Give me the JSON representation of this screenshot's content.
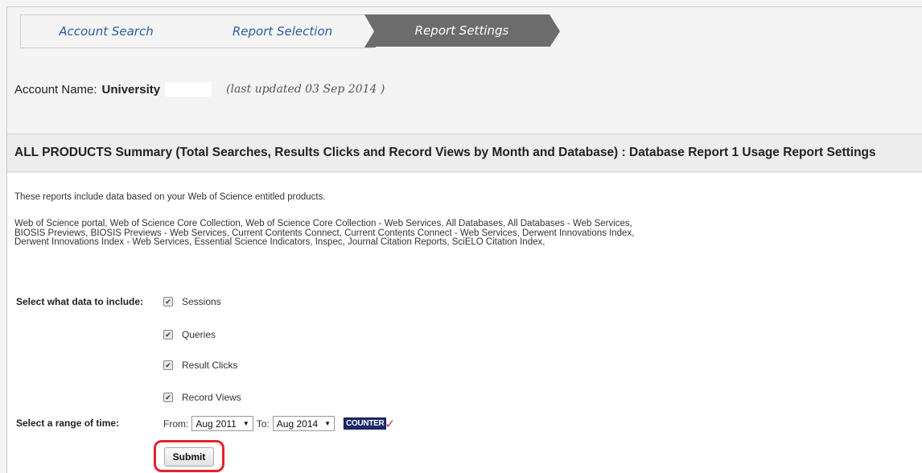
{
  "steps": [
    {
      "label": "Account Search"
    },
    {
      "label": "Report Selection"
    },
    {
      "label": "Report Settings"
    }
  ],
  "account": {
    "label": "Account Name:",
    "name": "University",
    "updated": "(last updated 03 Sep 2014 )"
  },
  "section_title": "ALL PRODUCTS Summary (Total Searches, Results Clicks and Record Views by Month and Database) : Database Report 1 Usage Report Settings",
  "intro": "These reports include data based on your Web of Science entitled products.",
  "products_lines": [
    "Web of Science portal, Web of Science Core Collection, Web of Science Core Collection - Web Services, All Databases, All Databases - Web Services,",
    "BIOSIS Previews, BIOSIS Previews - Web Services, Current Contents Connect, Current Contents Connect - Web Services, Derwent Innovations Index,",
    "Derwent Innovations Index - Web Services, Essential Science Indicators, Inspec, Journal Citation Reports, SciELO Citation Index,"
  ],
  "include_label": "Select what data to include:",
  "include_options": [
    {
      "label": "Sessions",
      "checked": true
    },
    {
      "label": "Queries",
      "checked": true
    },
    {
      "label": "Result Clicks",
      "checked": true
    },
    {
      "label": "Record Views",
      "checked": true
    }
  ],
  "time_label": "Select a range of time:",
  "time": {
    "from_label": "From:",
    "from_value": "Aug 2011",
    "to_label": "To:",
    "to_value": "Aug 2014",
    "counter_badge": "COUNTER",
    "counter_tick": "✓"
  },
  "submit_label": "Submit",
  "colors": {
    "link_blue": "#2b5f9e",
    "active_step": "#6c6c6c",
    "highlight_red": "#e2242c"
  }
}
